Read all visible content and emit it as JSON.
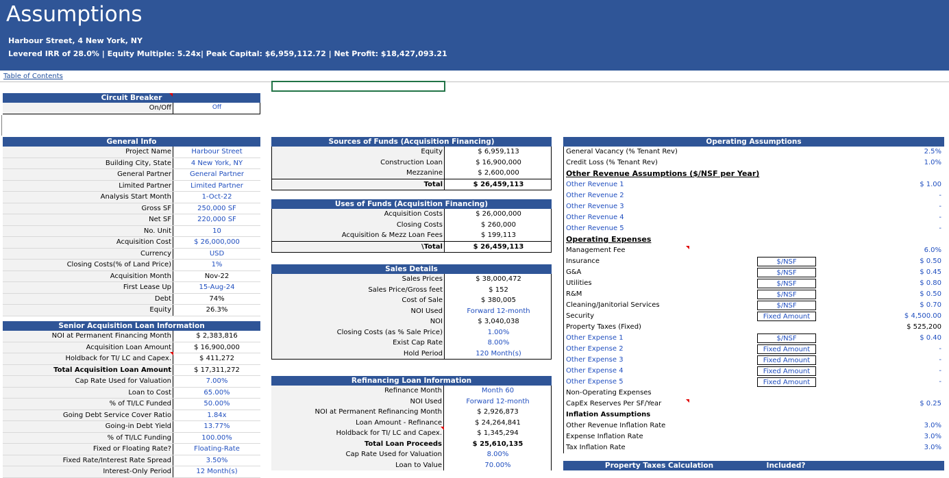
{
  "banner": {
    "title": "Assumptions",
    "address": "Harbour Street, 4 New York, NY",
    "metrics": "Levered IRR of 28.0% | Equity Multiple: 5.24x| Peak Capital: $6,959,112.72 | Net Profit: $18,427,093.21"
  },
  "toc": "Table of Contents",
  "circuit": {
    "title": "Circuit Breaker",
    "label": "On/Off",
    "value": "Off"
  },
  "general": {
    "title": "General Info",
    "rows": [
      {
        "l": "Project Name",
        "v": "Harbour Street"
      },
      {
        "l": "Building City, State",
        "v": "4 New York, NY"
      },
      {
        "l": "General Partner",
        "v": "General Partner"
      },
      {
        "l": "Limited Partner",
        "v": "Limited Partner"
      },
      {
        "l": "Analysis Start Month",
        "v": "1-Oct-22"
      },
      {
        "l": "Gross SF",
        "v": "250,000 SF"
      },
      {
        "l": "Net SF",
        "v": "220,000 SF"
      },
      {
        "l": "No. Unit",
        "v": "10"
      },
      {
        "l": "Acquisition Cost",
        "v": "$ 26,000,000"
      },
      {
        "l": "Currency",
        "v": "USD"
      },
      {
        "l": "Closing Costs(% of Land Price)",
        "v": "1%"
      },
      {
        "l": "Acquisition Month",
        "v": "Nov-22"
      },
      {
        "l": "First Lease Up",
        "v": "15-Aug-24"
      },
      {
        "l": "Debt",
        "v": "74%"
      },
      {
        "l": "Equity",
        "v": "26.3%"
      }
    ]
  },
  "senior": {
    "title": "Senior Acquisition Loan Information",
    "rows": [
      {
        "l": "NOI at Permanent Financing Month",
        "v": "$ 2,383,816"
      },
      {
        "l": "Acquisition Loan Amount",
        "v": "$ 16,900,000"
      },
      {
        "l": "Holdback for TI/ LC and Capex.",
        "v": "$ 411,272"
      },
      {
        "l": "Total Acquisition Loan Amount",
        "v": "$ 17,311,272"
      },
      {
        "l": "Cap Rate Used for Valuation",
        "v": "7.00%"
      },
      {
        "l": "Loan to Cost",
        "v": "65.00%"
      },
      {
        "l": "% of TI/LC Funded",
        "v": "50.00%"
      },
      {
        "l": "Going Debt Service Cover Ratio",
        "v": "1.84x"
      },
      {
        "l": "Going-in Debt Yield",
        "v": "13.77%"
      },
      {
        "l": "% of TI/LC Funding",
        "v": "100.00%"
      },
      {
        "l": "Fixed or Floating Rate?",
        "v": "Floating-Rate"
      },
      {
        "l": "Fixed Rate/Interest Rate Spread",
        "v": "3.50%"
      },
      {
        "l": "Interest-Only Period",
        "v": "12 Month(s)"
      }
    ]
  },
  "sources": {
    "title": "Sources of Funds (Acquisition Financing)",
    "rows": [
      {
        "l": "Equity",
        "v": "$ 6,959,113"
      },
      {
        "l": "Construction Loan",
        "v": "$ 16,900,000"
      },
      {
        "l": "Mezzanine",
        "v": "$ 2,600,000"
      },
      {
        "l": "Total",
        "v": "$ 26,459,113"
      }
    ]
  },
  "uses": {
    "title": "Uses of Funds (Acquisition Financing)",
    "rows": [
      {
        "l": "Acquisition Costs",
        "v": "$ 26,000,000"
      },
      {
        "l": "Closing Costs",
        "v": "$ 260,000"
      },
      {
        "l": "Acquisition & Mezz Loan Fees",
        "v": "$ 199,113"
      },
      {
        "l": "\\Total",
        "v": "$ 26,459,113"
      }
    ]
  },
  "sales": {
    "title": "Sales Details",
    "rows": [
      {
        "l": "Sales Prices",
        "v": "$ 38,000,472"
      },
      {
        "l": "Sales Price/Gross feet",
        "v": "$ 152"
      },
      {
        "l": "Cost of Sale",
        "v": "$ 380,005"
      },
      {
        "l": "NOI Used",
        "v": "Forward 12-month"
      },
      {
        "l": "NOI",
        "v": "$ 3,040,038"
      },
      {
        "l": "Closing Costs (as % Sale Price)",
        "v": "1.00%"
      },
      {
        "l": "Exist Cap Rate",
        "v": "8.00%"
      },
      {
        "l": "Hold Period",
        "v": "120 Month(s)"
      }
    ]
  },
  "refi": {
    "title": "Refinancing Loan Information",
    "rows": [
      {
        "l": "Refinance Month",
        "v": "Month 60"
      },
      {
        "l": "NOI Used",
        "v": "Forward 12-month"
      },
      {
        "l": "NOI at Permanent Refinancing Month",
        "v": "$ 2,926,873"
      },
      {
        "l": "Loan Amount - Refinance",
        "v": "$ 24,264,841"
      },
      {
        "l": "Holdback for TI/ LC and Capex.",
        "v": "$ 1,345,294"
      },
      {
        "l": "Total Loan Proceeds",
        "v": "$ 25,610,135"
      },
      {
        "l": "Cap Rate Used for Valuation",
        "v": "8.00%"
      },
      {
        "l": "Loan to Value",
        "v": "70.00%"
      }
    ]
  },
  "operating": {
    "title": "Operating Assumptions",
    "rows": [
      {
        "l": "General Vacancy (% Tenant Rev)",
        "u": "",
        "v": "2.5%"
      },
      {
        "l": "Credit Loss (% Tenant Rev)",
        "u": "",
        "v": "1.0%"
      },
      {
        "l": "Other  Revenue Assumptions ($/NSF per Year)",
        "u": "",
        "v": ""
      },
      {
        "l": "Other Revenue 1",
        "u": "",
        "v": "$ 1.00"
      },
      {
        "l": "Other Revenue 2",
        "u": "",
        "v": "-"
      },
      {
        "l": "Other Revenue 3",
        "u": "",
        "v": "-"
      },
      {
        "l": "Other Revenue 4",
        "u": "",
        "v": "-"
      },
      {
        "l": "Other Revenue 5",
        "u": "",
        "v": "-"
      },
      {
        "l": "Operating Expenses",
        "u": "",
        "v": ""
      },
      {
        "l": "Management Fee",
        "u": "",
        "v": "6.0%"
      },
      {
        "l": "Insurance",
        "u": "$/NSF",
        "v": "$ 0.50"
      },
      {
        "l": "G&A",
        "u": "$/NSF",
        "v": "$ 0.45"
      },
      {
        "l": "Utilities",
        "u": "$/NSF",
        "v": "$ 0.80"
      },
      {
        "l": "R&M",
        "u": "$/NSF",
        "v": "$ 0.50"
      },
      {
        "l": "Cleaning/Janitorial Services",
        "u": "$/NSF",
        "v": "$ 0.70"
      },
      {
        "l": "Security",
        "u": "Fixed Amount",
        "v": "$ 4,500.00"
      },
      {
        "l": "Property Taxes (Fixed)",
        "u": "",
        "v": "$ 525,200"
      },
      {
        "l": "Other Expense 1",
        "u": "$/NSF",
        "v": "$ 0.40"
      },
      {
        "l": "Other Expense 2",
        "u": "Fixed Amount",
        "v": "-"
      },
      {
        "l": "Other Expense 3",
        "u": "Fixed Amount",
        "v": "-"
      },
      {
        "l": "Other Expense 4",
        "u": "Fixed Amount",
        "v": "-"
      },
      {
        "l": "Other Expense 5",
        "u": "Fixed Amount",
        "v": "-"
      },
      {
        "l": "Non-Operating Expenses",
        "u": "",
        "v": ""
      },
      {
        "l": "CapEx Reserves Per SF/Year",
        "u": "",
        "v": "$ 0.25"
      },
      {
        "l": "Inflation Assumptions",
        "u": "",
        "v": ""
      },
      {
        "l": "Other Revenue Inflation Rate",
        "u": "",
        "v": "3.0%"
      },
      {
        "l": "Expense Inflation Rate",
        "u": "",
        "v": "3.0%"
      },
      {
        "l": "Tax Inflation Rate",
        "u": "",
        "v": "3.0%"
      }
    ]
  },
  "ptax": {
    "title": "Property Taxes Calculation",
    "included": "Included?"
  }
}
